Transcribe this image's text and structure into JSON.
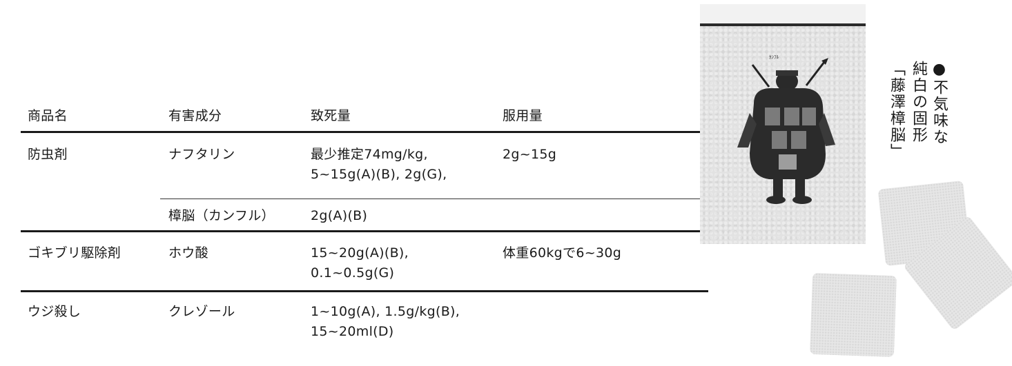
{
  "table": {
    "headers": [
      "商品名",
      "有害成分",
      "致死量",
      "服用量"
    ],
    "rows": [
      {
        "product": "防虫剤",
        "ingredient": "ナフタリン",
        "lethal_1": "最少推定74mg/kg,",
        "lethal_2": "5~15g(A)(B), 2g(G),",
        "dose": "2g~15g"
      },
      {
        "product": "",
        "ingredient": "樟脳（カンフル）",
        "lethal_1": "2g(A)(B)",
        "lethal_2": "",
        "dose": ""
      },
      {
        "product": "ゴキブリ駆除剤",
        "ingredient": "ホウ酸",
        "lethal_1": "15~20g(A)(B),",
        "lethal_2": "0.1~0.5g(G)",
        "dose": "体重60kgで6~30g"
      },
      {
        "product": "ウジ殺し",
        "ingredient": "クレゾール",
        "lethal_1": "1~10g(A), 1.5g/kg(B),",
        "lethal_2": "15~20ml(D)",
        "dose": ""
      }
    ]
  },
  "caption": {
    "line1": "●不気味な",
    "line2": "純白の固形",
    "line3": "「藤澤樟脳」"
  },
  "photo": {
    "brand_small": "ｶﾝﾌﾙ"
  }
}
